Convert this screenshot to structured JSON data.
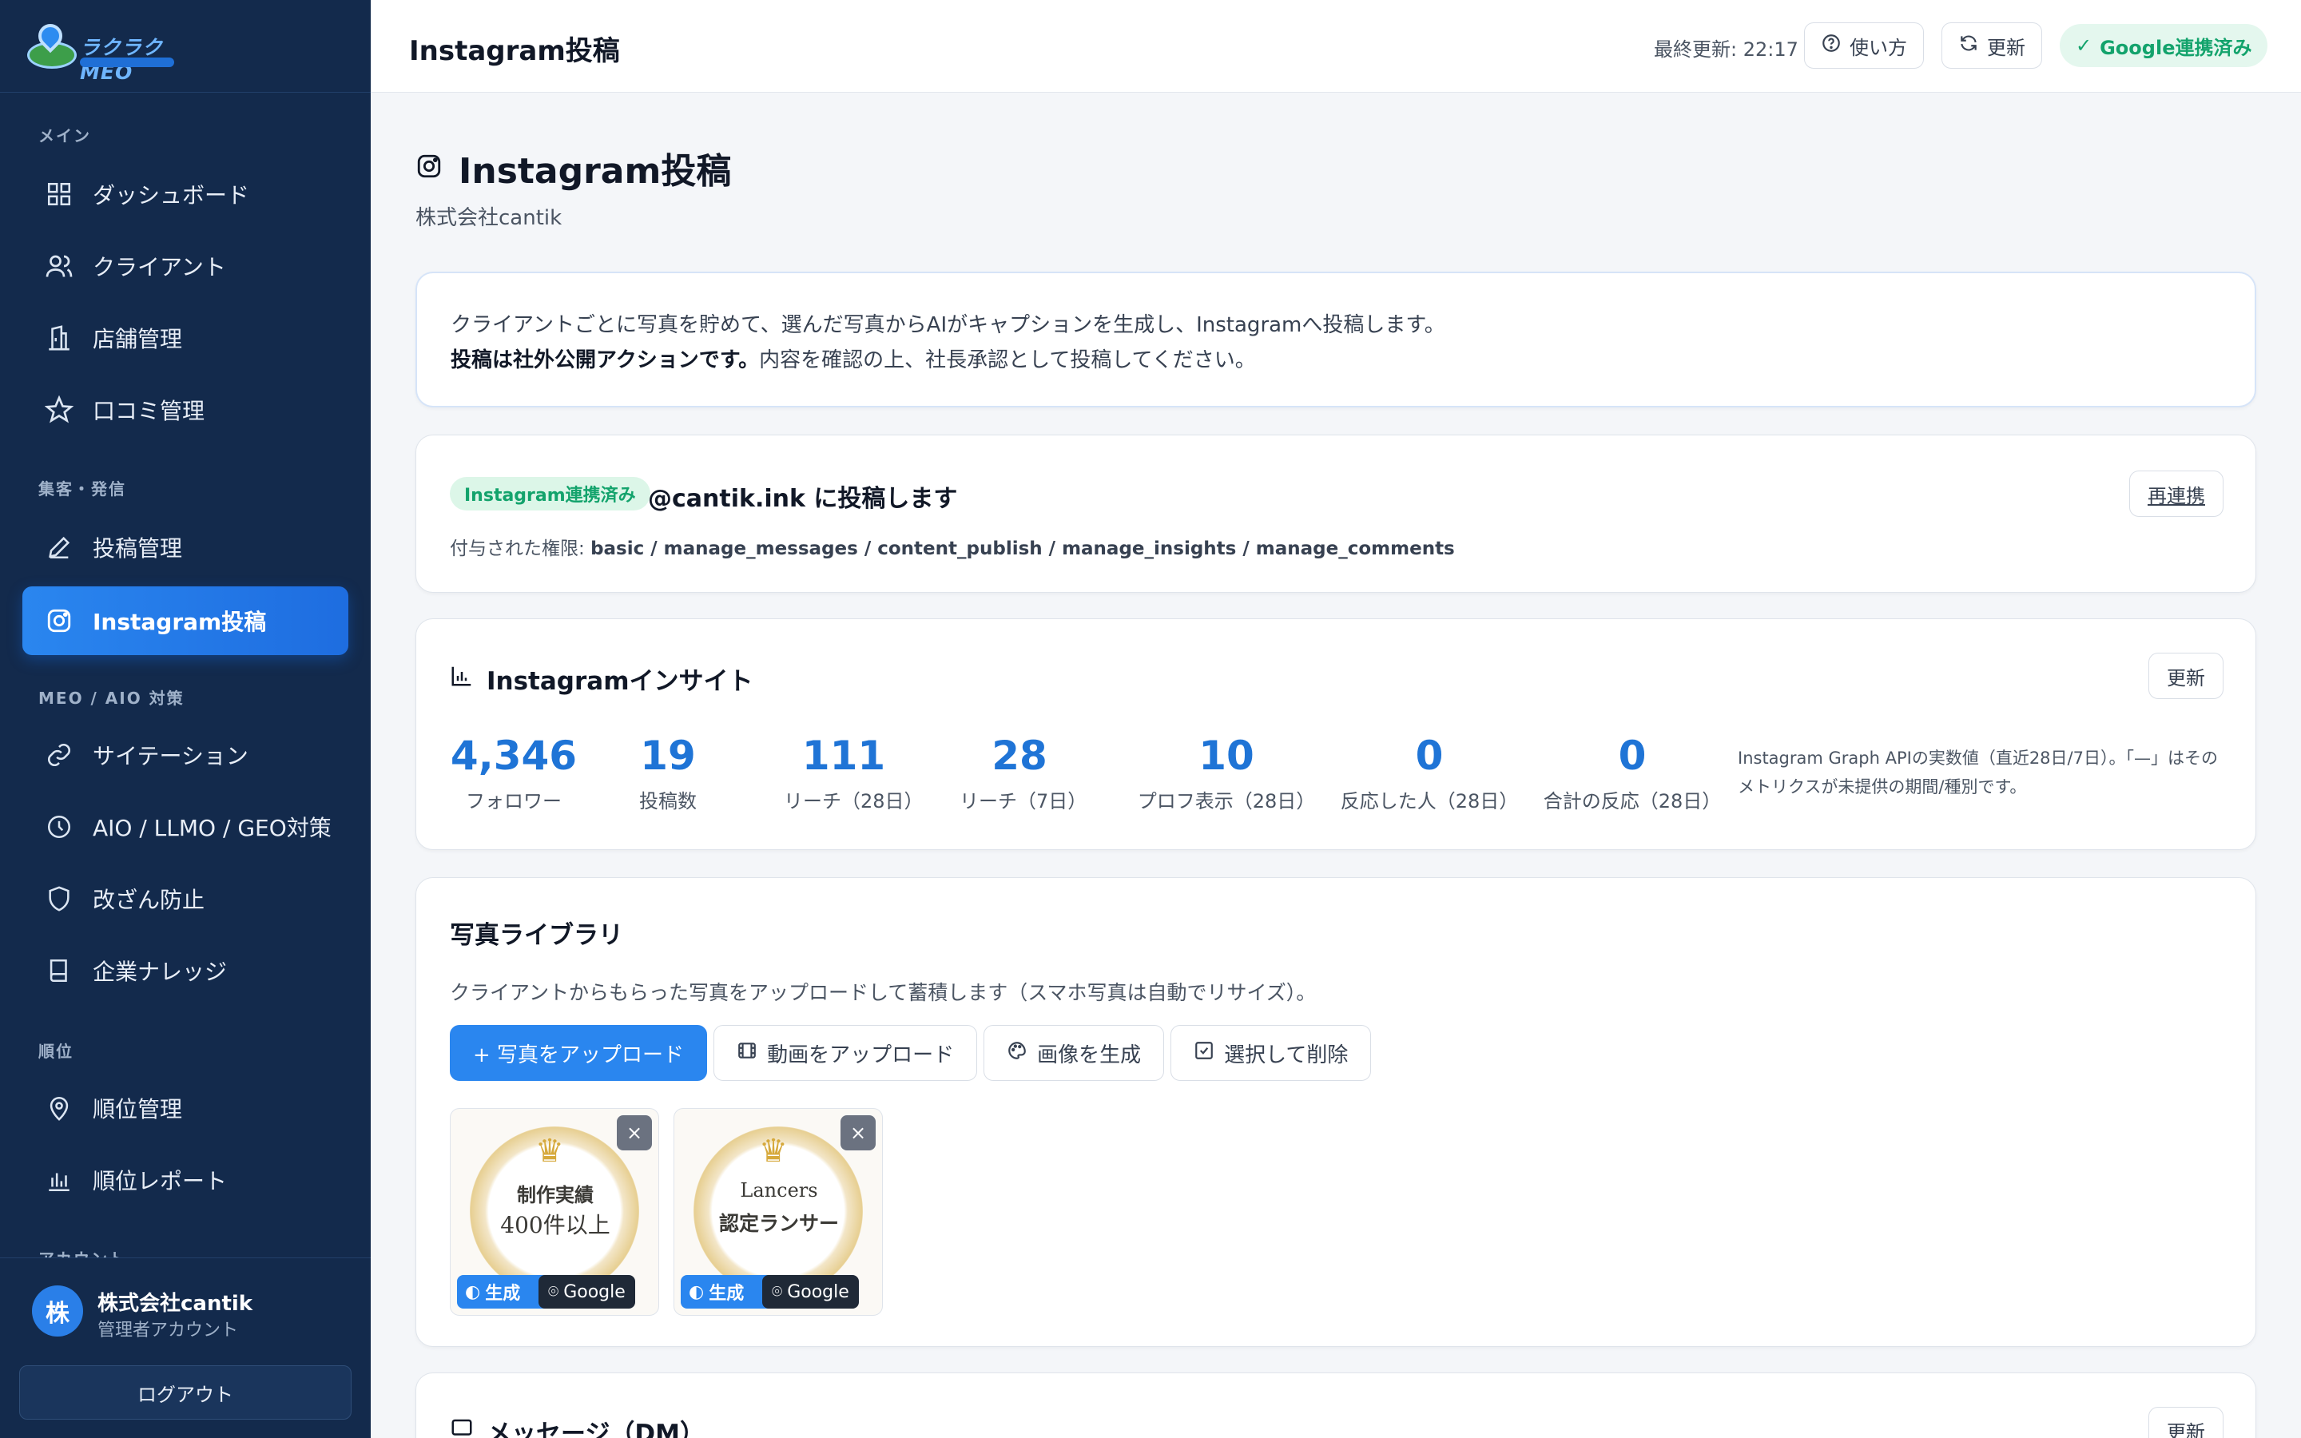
{
  "brand": {
    "name": "ラクラクMEO"
  },
  "sidebar": {
    "sections": [
      {
        "label": "メイン"
      },
      {
        "label": "集客・発信"
      },
      {
        "label": "MEO / AIO 対策"
      },
      {
        "label": "順位"
      },
      {
        "label": "アカウント"
      }
    ],
    "items": [
      {
        "label": "ダッシュボード",
        "icon": "grid-icon"
      },
      {
        "label": "クライアント",
        "icon": "users-icon"
      },
      {
        "label": "店舗管理",
        "icon": "building-icon"
      },
      {
        "label": "口コミ管理",
        "icon": "star-icon"
      },
      {
        "label": "投稿管理",
        "icon": "pencil-icon"
      },
      {
        "label": "Instagram投稿",
        "icon": "instagram-icon",
        "active": true
      },
      {
        "label": "サイテーション",
        "icon": "link-icon"
      },
      {
        "label": "AIO / LLMO / GEO対策",
        "icon": "clock-icon"
      },
      {
        "label": "改ざん防止",
        "icon": "shield-icon"
      },
      {
        "label": "企業ナレッジ",
        "icon": "book-icon"
      },
      {
        "label": "順位管理",
        "icon": "map-pin-icon"
      },
      {
        "label": "順位レポート",
        "icon": "bar-chart-icon"
      }
    ],
    "footer": {
      "avatar": "株",
      "name": "株式会社cantik",
      "role": "管理者アカウント",
      "logout": "ログアウト"
    }
  },
  "header": {
    "title": "Instagram投稿",
    "last_update": "最終更新: 22:17",
    "help": "使い方",
    "refresh": "更新",
    "google_status": "Google連携済み"
  },
  "page": {
    "title": "Instagram投稿",
    "subtitle": "株式会社cantik"
  },
  "intro": {
    "line1": "クライアントごとに写真を貯めて、選んだ写真からAIがキャプションを生成し、Instagramへ投稿します。",
    "line2_bold": "投稿は社外公開アクションです。",
    "line2_rest": "内容を確認の上、社長承認として投稿してください。"
  },
  "account": {
    "badge": "Instagram連携済み",
    "publish_to": "@cantik.ink に投稿します",
    "perm_label": "付与された権限: ",
    "perm_values": "basic / manage_messages / content_publish / manage_insights / manage_comments",
    "relink": "再連携"
  },
  "insights": {
    "title": "Instagramインサイト",
    "refresh": "更新",
    "stats": [
      {
        "value": "4,346",
        "label": "フォロワー"
      },
      {
        "value": "19",
        "label": "投稿数"
      },
      {
        "value": "111",
        "label": "リーチ（28日）"
      },
      {
        "value": "28",
        "label": "リーチ（7日）"
      },
      {
        "value": "10",
        "label": "プロフ表示（28日）"
      },
      {
        "value": "0",
        "label": "反応した人（28日）"
      },
      {
        "value": "0",
        "label": "合計の反応（28日）"
      }
    ],
    "note": "Instagram Graph APIの実数値（直近28日/7日）。「—」はそのメトリクスが未提供の期間/種別です。"
  },
  "library": {
    "title": "写真ライブラリ",
    "desc": "クライアントからもらった写真をアップロードして蓄積します（スマホ写真は自動でリサイズ）。",
    "buttons": {
      "upload_photo": "+ 写真をアップロード",
      "upload_video": "動画をアップロード",
      "generate_image": "画像を生成",
      "select_delete": "選択して削除"
    },
    "photos": [
      {
        "line1": "制作実績",
        "line2": "400件以上",
        "generate": "生成",
        "google": "Google",
        "close": "×"
      },
      {
        "line1": "Lancers",
        "line2": "認定ランサー",
        "generate": "生成",
        "google": "Google",
        "close": "×"
      }
    ]
  },
  "messages": {
    "title": "メッセージ（DM）",
    "refresh": "更新"
  },
  "colors": {
    "sidebar": "#132a4c",
    "accent": "#2a86ef",
    "success": "#13a36c",
    "stat": "#1f74d6"
  }
}
